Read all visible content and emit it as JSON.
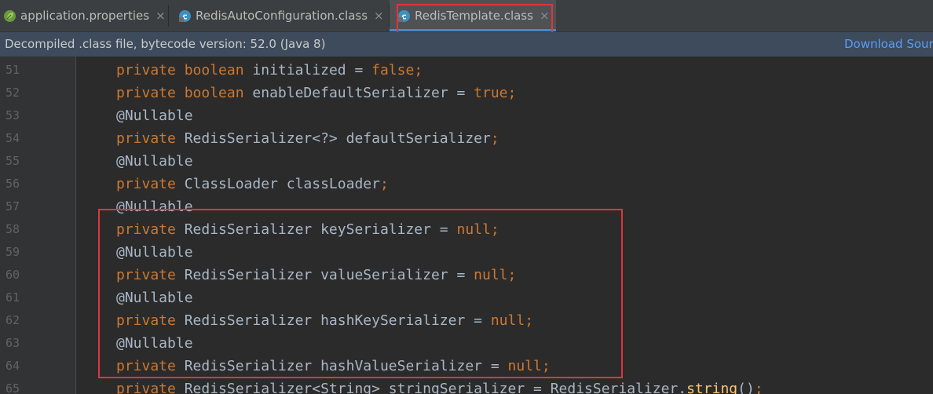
{
  "tabs": [
    {
      "label": "application.properties",
      "icon": "spring-leaf-icon",
      "active": false
    },
    {
      "label": "RedisAutoConfiguration.class",
      "icon": "class-file-icon",
      "active": false
    },
    {
      "label": "RedisTemplate.class",
      "icon": "class-file-icon",
      "active": true
    }
  ],
  "tab_close_glyph": "×",
  "infobar": {
    "message": "Decompiled .class file, bytecode version: 52.0 (Java 8)",
    "link": "Download Sour"
  },
  "colors": {
    "keyword": "#cc7832",
    "annotation": "#bbb529",
    "identifier": "#a9b7c6",
    "line_number": "#606366",
    "highlight": "#e0353a",
    "accent": "#4a88c7"
  },
  "code_lines": [
    {
      "number": "51",
      "tokens": [
        [
          "kw",
          "private "
        ],
        [
          "kw",
          "boolean "
        ],
        [
          "id",
          "initialized = "
        ],
        [
          "kw",
          "false"
        ],
        [
          "kw",
          ";"
        ]
      ]
    },
    {
      "number": "52",
      "tokens": [
        [
          "kw",
          "private "
        ],
        [
          "kw",
          "boolean "
        ],
        [
          "id",
          "enableDefaultSerializer = "
        ],
        [
          "kw",
          "true"
        ],
        [
          "kw",
          ";"
        ]
      ]
    },
    {
      "number": "53",
      "tokens": [
        [
          "ann",
          "@Nullable"
        ]
      ]
    },
    {
      "number": "54",
      "tokens": [
        [
          "kw",
          "private "
        ],
        [
          "id",
          "RedisSerializer<?> defaultSerializer"
        ],
        [
          "kw",
          ";"
        ]
      ]
    },
    {
      "number": "55",
      "tokens": [
        [
          "ann",
          "@Nullable"
        ]
      ]
    },
    {
      "number": "56",
      "tokens": [
        [
          "kw",
          "private "
        ],
        [
          "id",
          "ClassLoader classLoader"
        ],
        [
          "kw",
          ";"
        ]
      ]
    },
    {
      "number": "57",
      "tokens": [
        [
          "ann",
          "@Nullable"
        ]
      ]
    },
    {
      "number": "58",
      "tokens": [
        [
          "kw",
          "private "
        ],
        [
          "id",
          "RedisSerializer keySerializer = "
        ],
        [
          "kw",
          "null"
        ],
        [
          "kw",
          ";"
        ]
      ]
    },
    {
      "number": "59",
      "tokens": [
        [
          "ann",
          "@Nullable"
        ]
      ]
    },
    {
      "number": "60",
      "tokens": [
        [
          "kw",
          "private "
        ],
        [
          "id",
          "RedisSerializer valueSerializer = "
        ],
        [
          "kw",
          "null"
        ],
        [
          "kw",
          ";"
        ]
      ]
    },
    {
      "number": "61",
      "tokens": [
        [
          "ann",
          "@Nullable"
        ]
      ]
    },
    {
      "number": "62",
      "tokens": [
        [
          "kw",
          "private "
        ],
        [
          "id",
          "RedisSerializer hashKeySerializer = "
        ],
        [
          "kw",
          "null"
        ],
        [
          "kw",
          ";"
        ]
      ]
    },
    {
      "number": "63",
      "tokens": [
        [
          "ann",
          "@Nullable"
        ]
      ]
    },
    {
      "number": "64",
      "tokens": [
        [
          "kw",
          "private "
        ],
        [
          "id",
          "RedisSerializer hashValueSerializer = "
        ],
        [
          "kw",
          "null"
        ],
        [
          "kw",
          ";"
        ]
      ]
    },
    {
      "number": "65",
      "tokens": [
        [
          "kw",
          "private "
        ],
        [
          "id",
          "RedisSerializer<String> stringSerializer = RedisSerializer."
        ],
        [
          "fn",
          "string"
        ],
        [
          "id",
          "()"
        ],
        [
          "kw",
          ";"
        ]
      ]
    }
  ]
}
